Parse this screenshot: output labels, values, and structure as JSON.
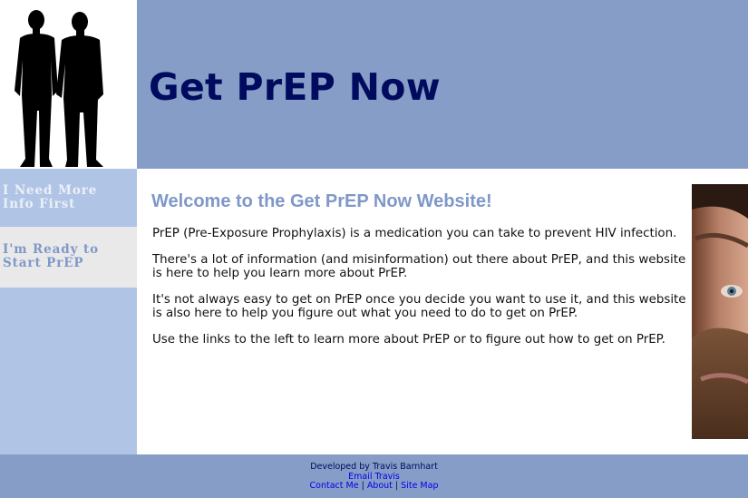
{
  "header": {
    "title": "Get PrEP Now"
  },
  "sidebar": {
    "items": [
      {
        "line1": "I Need More",
        "line2": "Info First"
      },
      {
        "line1": "I'm Ready to",
        "line2": "Start PrEP"
      }
    ]
  },
  "main": {
    "welcome": "Welcome to the Get PrEP Now Website!",
    "paragraphs": [
      "PrEP (Pre-Exposure Prophylaxis) is a medication you can take to prevent HIV infection.",
      "There's a lot of information (and misinformation) out there about PrEP, and this website is here to help you learn more about PrEP.",
      "It's not always easy to get on PrEP once you decide you want to use it, and this website is also here to help you figure out what you need to do to get on PrEP.",
      "Use the links to the left to learn more about PrEP or to figure out how to get on PrEP."
    ]
  },
  "footer": {
    "developed_by": "Developed by Travis Barnhart",
    "email_link": "Email Travis",
    "links": [
      "Contact Me",
      "About",
      "Site Map"
    ],
    "separator": "|"
  },
  "colors": {
    "header_bg": "#869dc7",
    "title_color": "#000a5e",
    "sidebar_bg": "#b0c4e6",
    "accent": "#7f98c8"
  }
}
